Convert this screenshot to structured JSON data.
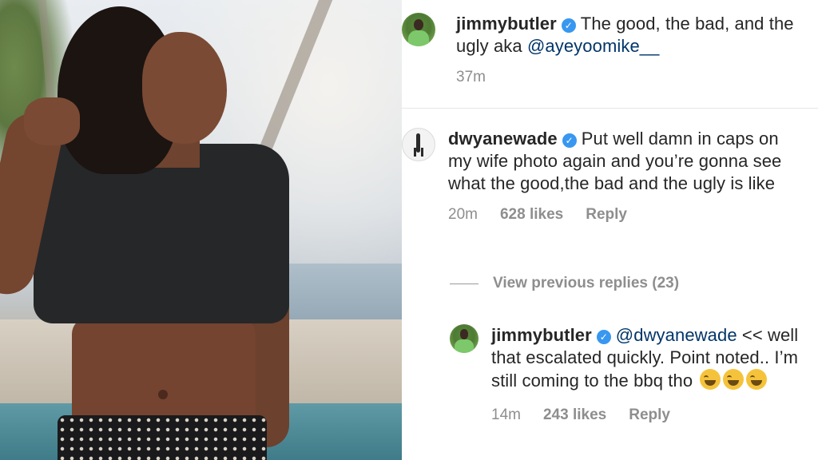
{
  "comments": [
    {
      "username": "jimmybutler",
      "text": "The good, the bad, and the ugly aka",
      "mention": "@ayeyoomike__",
      "time": "37m"
    },
    {
      "username": "dwyanewade",
      "text": "Put well damn in caps on my wife photo again and you’re gonna see what the good,the bad and the ugly is like",
      "time": "20m",
      "likes": "628 likes",
      "reply": "Reply"
    }
  ],
  "view_previous": "View previous replies (23)",
  "reply_comment": {
    "username": "jimmybutler",
    "mention": "@dwyanewade",
    "text": "<< well that escalated quickly. Point noted.. I’m still coming to the bbq tho",
    "emojis": [
      "face-with-tears-of-joy",
      "face-with-tears-of-joy",
      "face-with-tears-of-joy"
    ],
    "time": "14m",
    "likes": "243 likes",
    "reply": "Reply"
  },
  "colors": {
    "verified_badge": "#3897f0",
    "mention": "#003569",
    "meta_gray": "#8e8e8e",
    "text": "#262626"
  }
}
